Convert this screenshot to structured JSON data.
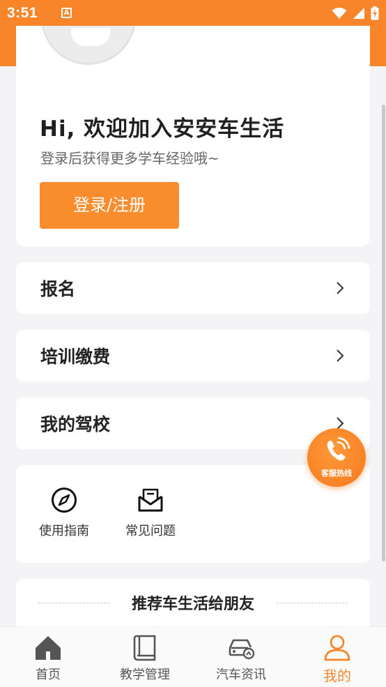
{
  "status_bar": {
    "time": "3:51",
    "notification_letter": "A"
  },
  "profile": {
    "title": "Hi, 欢迎加入安安车生活",
    "subtitle": "登录后获得更多学车经验哦~",
    "login_label": "登录/注册"
  },
  "menu": {
    "items": [
      {
        "label": "报名"
      },
      {
        "label": "培训缴费"
      },
      {
        "label": "我的驾校"
      }
    ]
  },
  "tools": {
    "items": [
      {
        "label": "使用指南",
        "icon": "compass-icon"
      },
      {
        "label": "常见问题",
        "icon": "mail-icon"
      }
    ]
  },
  "hotline": {
    "label": "客服热线",
    "icon": "phone-icon"
  },
  "recommend": {
    "title": "推荐车生活给朋友"
  },
  "bottom_nav": {
    "items": [
      {
        "label": "首页",
        "icon": "home-icon"
      },
      {
        "label": "教学管理",
        "icon": "book-icon"
      },
      {
        "label": "汽车资讯",
        "icon": "car-icon"
      },
      {
        "label": "我的",
        "icon": "person-icon",
        "active": true
      }
    ]
  },
  "colors": {
    "accent": "#f8852a",
    "button": "#f98d2e",
    "background": "#f4f4f6",
    "nav_inactive": "#555555"
  }
}
